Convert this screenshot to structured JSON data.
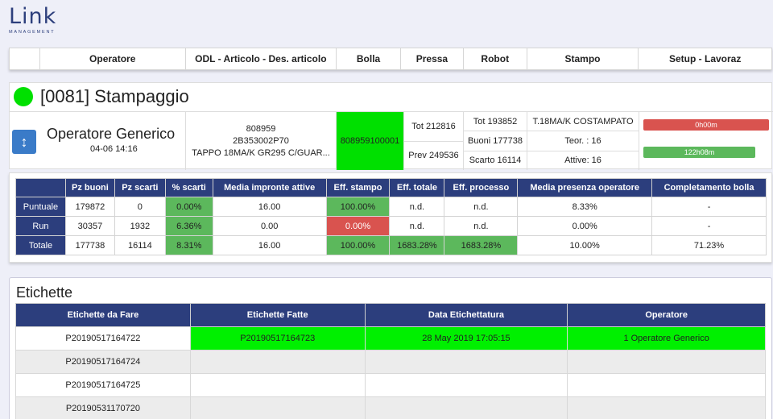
{
  "logo": {
    "main": "Link",
    "sub": "MANAGEMENT"
  },
  "nav": [
    "",
    "Operatore",
    "ODL - Articolo - Des. articolo",
    "Bolla",
    "Pressa",
    "Robot",
    "Stampo",
    "Setup - Lavoraz"
  ],
  "panel": {
    "title": "[0081] Stampaggio",
    "status_color": "#00e000",
    "operator_name": "Operatore Generico",
    "operator_date": "04-06 14:16",
    "odl": "808959",
    "articolo": "2B353002P70",
    "descrizione": "TAPPO 18MA/K GR295 C/GUAR...",
    "bolla": "808959100001",
    "tot": "Tot 212816",
    "prev": "Prev 249536",
    "tot2": "Tot 193852",
    "buoni": "Buoni 177738",
    "scarto": "Scarto 16114",
    "stampo": "T.18MA/K COSTAMPATO",
    "teor": "Teor. : 16",
    "attive": "Attive: 16",
    "bar1": {
      "label": "0h00m",
      "color": "#d9534f"
    },
    "bar2": {
      "label": "122h08m",
      "color": "#5cb85c"
    }
  },
  "stats": {
    "headers": [
      "",
      "Pz buoni",
      "Pz scarti",
      "% scarti",
      "Media impronte attive",
      "Eff. stampo",
      "Eff. totale",
      "Eff. processo",
      "Media presenza operatore",
      "Completamento bolla"
    ],
    "rows": [
      {
        "label": "Puntuale",
        "cells": [
          "179872",
          "0",
          "0.00%",
          "16.00",
          "100.00%",
          "n.d.",
          "n.d.",
          "8.33%",
          "-"
        ]
      },
      {
        "label": "Run",
        "cells": [
          "30357",
          "1932",
          "6.36%",
          "0.00",
          "0.00%",
          "n.d.",
          "n.d.",
          "0.00%",
          "-"
        ]
      },
      {
        "label": "Totale",
        "cells": [
          "177738",
          "16114",
          "8.31%",
          "16.00",
          "100.00%",
          "1683.28%",
          "1683.28%",
          "10.00%",
          "71.23%"
        ]
      }
    ]
  },
  "etichette": {
    "title": "Etichette",
    "headers": [
      "Etichette da Fare",
      "Etichette Fatte",
      "Data Etichettatura",
      "Operatore"
    ],
    "rows": [
      [
        "P20190517164722",
        "P20190517164723",
        "28 May 2019 17:05:15",
        "1 Operatore Generico"
      ],
      [
        "P20190517164724",
        "",
        "",
        ""
      ],
      [
        "P20190517164725",
        "",
        "",
        ""
      ],
      [
        "P20190531170720",
        "",
        "",
        ""
      ]
    ]
  }
}
